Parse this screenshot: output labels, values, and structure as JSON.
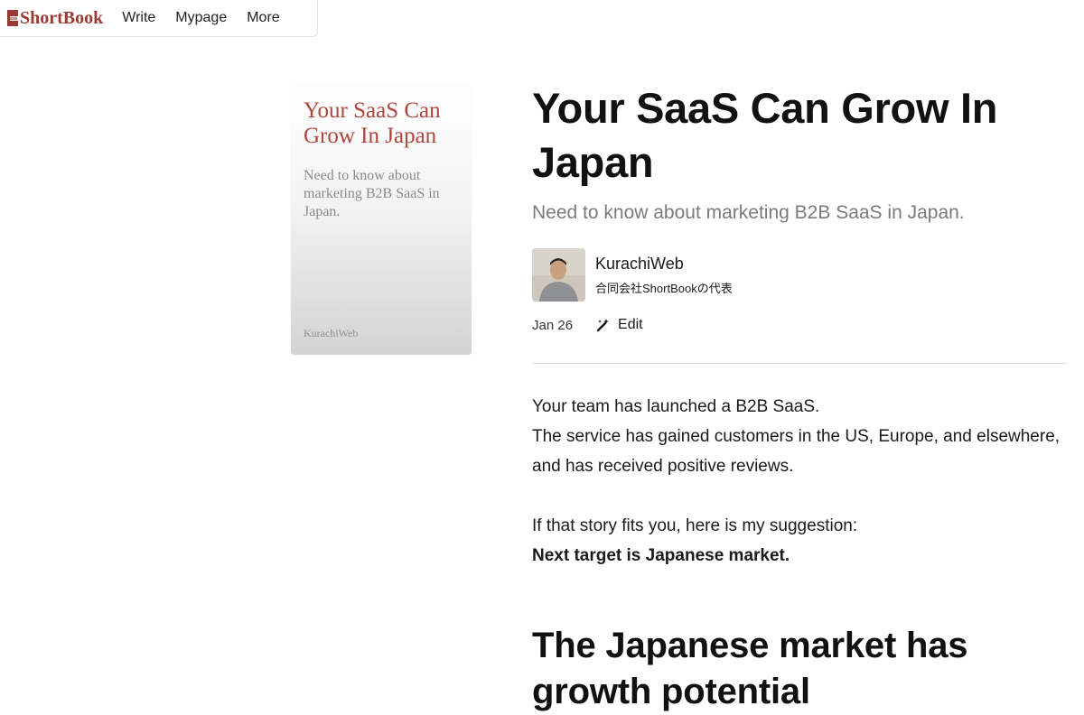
{
  "nav": {
    "logo": "ShortBook",
    "items": [
      "Write",
      "Mypage",
      "More"
    ]
  },
  "cover": {
    "title": "Your SaaS Can Grow In Japan",
    "subtitle": "Need to know about marketing B2B SaaS in Japan.",
    "author": "KurachiWeb"
  },
  "article": {
    "title": "Your SaaS Can Grow In Japan",
    "subtitle": "Need to know about marketing B2B SaaS in Japan.",
    "author_name": "KurachiWeb",
    "author_bio": "合同会社ShortBookの代表",
    "date": "Jan 26",
    "edit_label": "Edit",
    "p1_line1": "Your team has launched a B2B SaaS.",
    "p1_line2": "The service has gained customers in the US, Europe, and elsewhere, and has received positive reviews.",
    "p2_line1": "If that story fits you, here is my suggestion:",
    "p2_bold": "Next target is Japanese market.",
    "heading2": "The Japanese market has growth potential"
  },
  "colors": {
    "brand": "#9b3a34",
    "cover_title": "#b0453e"
  },
  "icons": [
    "bookmark-logo-icon",
    "magic-wand-icon"
  ]
}
